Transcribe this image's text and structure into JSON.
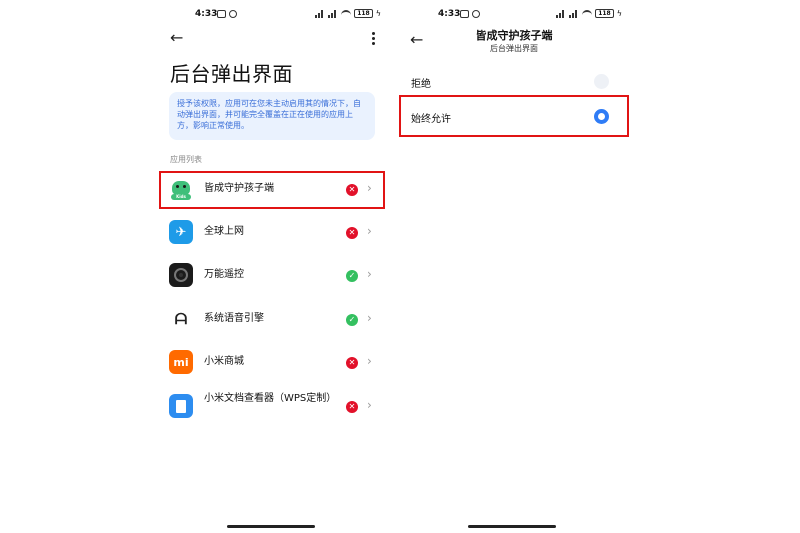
{
  "left_screen": {
    "status_bar": {
      "time": "4:33",
      "battery": "118"
    },
    "title": "后台弹出界面",
    "info_text": "授予该权限，应用可在您未主动启用其的情况下，自动弹出界面，并可能完全覆盖在正在使用的应用上方，影响正常使用。",
    "section_label": "应用列表",
    "apps": [
      {
        "name": "皆成守护孩子端",
        "status": "deny",
        "icon": "kids-app-icon",
        "icon_text": "Kids"
      },
      {
        "name": "全球上网",
        "status": "deny",
        "icon": "global-internet-icon",
        "icon_text": "✈"
      },
      {
        "name": "万能遥控",
        "status": "allow",
        "icon": "remote-control-icon",
        "icon_text": ""
      },
      {
        "name": "系统语音引擎",
        "status": "allow",
        "icon": "voice-engine-icon",
        "icon_text": "ᗩ"
      },
      {
        "name": "小米商城",
        "status": "deny",
        "icon": "xiaomi-store-icon",
        "icon_text": "mi"
      },
      {
        "name": "小米文档查看器（WPS定制）",
        "status": "deny",
        "icon": "document-viewer-icon",
        "icon_text": ""
      }
    ],
    "status_glyphs": {
      "deny": "✕",
      "allow": "✓"
    },
    "chevron_glyph": "›"
  },
  "right_screen": {
    "status_bar": {
      "time": "4:33",
      "battery": "118"
    },
    "title": "皆成守护孩子端",
    "subtitle": "后台弹出界面",
    "options": [
      {
        "label": "拒绝",
        "selected": false
      },
      {
        "label": "始终允许",
        "selected": true
      }
    ]
  },
  "colors": {
    "highlight": "#e11414",
    "deny": "#e2112a",
    "allow": "#34c060",
    "radio_selected": "#2f7cf6",
    "info_text": "#3a6fd8",
    "info_bg": "#eaf2fe"
  }
}
